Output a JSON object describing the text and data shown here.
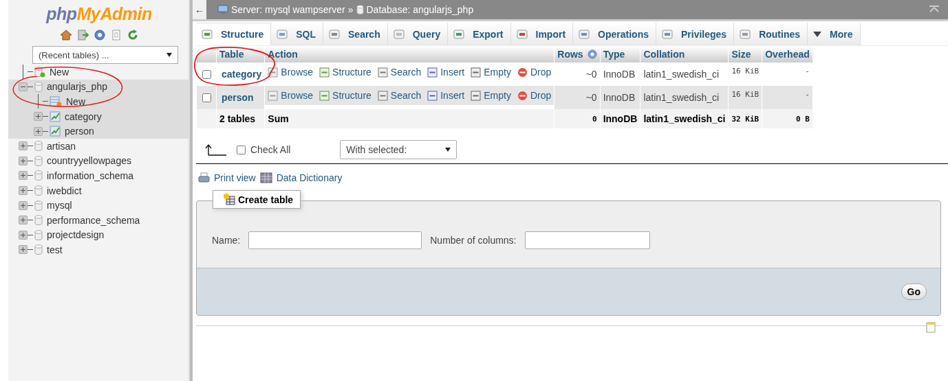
{
  "sidebar": {
    "logo": {
      "part_1": "php",
      "part_2": "MyAdmin"
    },
    "recent_tables": {
      "value": "(Recent tables) ..."
    },
    "tree": [
      {
        "label": "New",
        "kind": "new"
      },
      {
        "label": "angularjs_php",
        "kind": "database",
        "expanded": true,
        "selected": true,
        "children": [
          {
            "label": "New",
            "kind": "new"
          },
          {
            "label": "category",
            "kind": "table",
            "expanded": false
          },
          {
            "label": "person",
            "kind": "table",
            "expanded": false
          }
        ]
      },
      {
        "label": "artisan",
        "kind": "database",
        "expanded": false,
        "selected": false
      },
      {
        "label": "countryyellowpages",
        "kind": "database",
        "expanded": false,
        "selected": false
      },
      {
        "label": "information_schema",
        "kind": "database",
        "expanded": false,
        "selected": false
      },
      {
        "label": "iwebdict",
        "kind": "database",
        "expanded": false,
        "selected": false
      },
      {
        "label": "mysql",
        "kind": "database",
        "expanded": false,
        "selected": false
      },
      {
        "label": "performance_schema",
        "kind": "database",
        "expanded": false,
        "selected": false
      },
      {
        "label": "projectdesign",
        "kind": "database",
        "expanded": false,
        "selected": false
      },
      {
        "label": "test",
        "kind": "database",
        "expanded": false,
        "selected": false
      }
    ]
  },
  "breadcrumb": {
    "back": "←",
    "server": "Server: mysql wampserver",
    "separator": "»",
    "database": "Database: angularjs_php"
  },
  "tabs": [
    {
      "label": "Structure",
      "kind": "structure",
      "selected": true
    },
    {
      "label": "SQL",
      "kind": "sql",
      "selected": false
    },
    {
      "label": "Search",
      "kind": "search",
      "selected": false
    },
    {
      "label": "Query",
      "kind": "query",
      "selected": false
    },
    {
      "label": "Export",
      "kind": "export",
      "selected": false
    },
    {
      "label": "Import",
      "kind": "import",
      "selected": false
    },
    {
      "label": "Operations",
      "kind": "operations",
      "selected": false
    },
    {
      "label": "Privileges",
      "kind": "privileges",
      "selected": false
    },
    {
      "label": "Routines",
      "kind": "routines",
      "selected": false
    },
    {
      "label": "More",
      "kind": "more",
      "selected": false
    }
  ],
  "table": {
    "columns": [
      "Table",
      "Action",
      "Rows",
      "Type",
      "Collation",
      "Size",
      "Overhead"
    ],
    "rows": [
      {
        "checked": false,
        "name": "category",
        "actions": [
          {
            "kind": "browse",
            "label": "Browse"
          },
          {
            "kind": "structure",
            "label": "Structure"
          },
          {
            "kind": "search",
            "label": "Search"
          },
          {
            "kind": "insert",
            "label": "Insert"
          },
          {
            "kind": "empty",
            "label": "Empty"
          },
          {
            "kind": "drop",
            "label": "Drop"
          }
        ],
        "rows": "~0",
        "type": "InnoDB",
        "collation": "latin1_swedish_ci",
        "size": "16 KiB",
        "overhead": "-"
      },
      {
        "checked": false,
        "name": "person",
        "actions": [
          {
            "kind": "browse",
            "label": "Browse"
          },
          {
            "kind": "structure",
            "label": "Structure"
          },
          {
            "kind": "search",
            "label": "Search"
          },
          {
            "kind": "insert",
            "label": "Insert"
          },
          {
            "kind": "empty",
            "label": "Empty"
          },
          {
            "kind": "drop",
            "label": "Drop"
          }
        ],
        "rows": "~0",
        "type": "InnoDB",
        "collation": "latin1_swedish_ci",
        "size": "16 KiB",
        "overhead": "-"
      }
    ],
    "footer": {
      "count": "2 tables",
      "label": "Sum",
      "rows": "0",
      "type": "InnoDB",
      "collation": "latin1_swedish_ci",
      "size": "32 KiB",
      "overhead": "0 B"
    }
  },
  "bulk": {
    "check_all": {
      "label": "Check All",
      "checked": false
    },
    "with_selected": "With selected:"
  },
  "links": [
    "Print view",
    "Data Dictionary"
  ],
  "create_table": {
    "legend": "Create table",
    "name_label": "Name:",
    "columns_label": "Number of columns:",
    "go": "Go"
  }
}
